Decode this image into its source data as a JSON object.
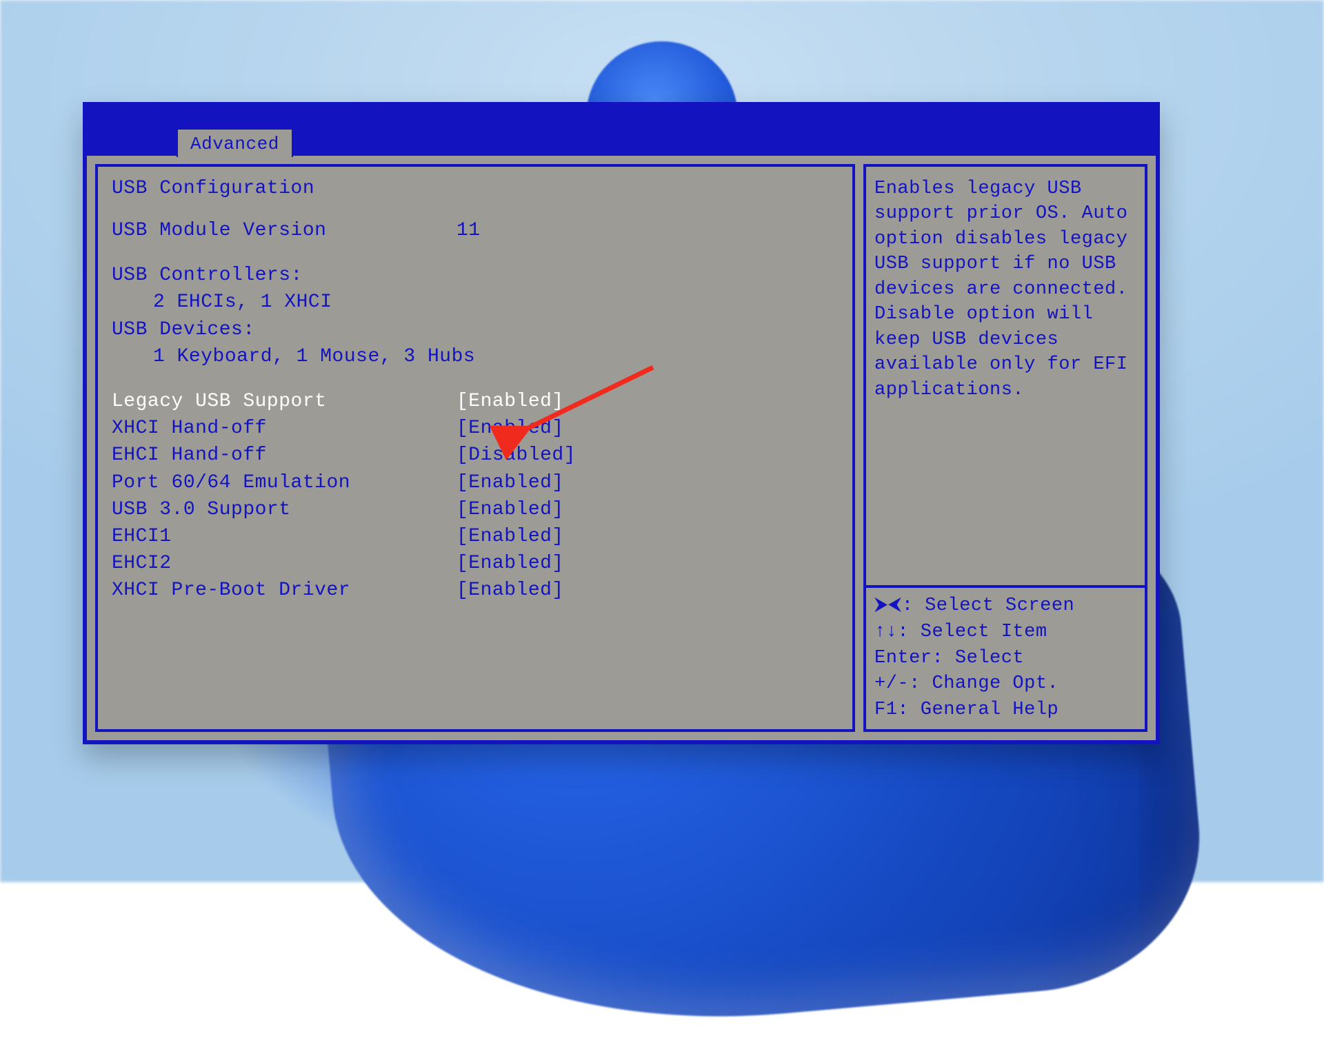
{
  "tab": {
    "label": "Advanced"
  },
  "left": {
    "section_title": "USB Configuration",
    "module_version": {
      "label": "USB Module Version",
      "value": "11"
    },
    "controllers_label": "USB Controllers:",
    "controllers_value": "2 EHCIs, 1 XHCI",
    "devices_label": "USB Devices:",
    "devices_value": "1 Keyboard, 1 Mouse, 3 Hubs",
    "settings": [
      {
        "label": "Legacy USB Support",
        "value": "[Enabled]",
        "selected": true
      },
      {
        "label": "XHCI Hand-off",
        "value": "[Enabled]",
        "selected": false
      },
      {
        "label": "EHCI Hand-off",
        "value": "[Disabled]",
        "selected": false
      },
      {
        "label": "Port 60/64 Emulation",
        "value": "[Enabled]",
        "selected": false
      },
      {
        "label": "USB 3.0 Support",
        "value": "[Enabled]",
        "selected": false
      },
      {
        "label": "EHCI1",
        "value": "[Enabled]",
        "selected": false
      },
      {
        "label": "EHCI2",
        "value": "[Enabled]",
        "selected": false
      },
      {
        "label": "XHCI Pre-Boot Driver",
        "value": "[Enabled]",
        "selected": false
      }
    ]
  },
  "help_text": "Enables legacy USB support prior OS. Auto option disables legacy USB support if no USB devices are connected. Disable option will keep USB devices available only for EFI applications.",
  "keys": {
    "select_screen": "⮞⮜: Select Screen",
    "select_item": "↑↓: Select Item",
    "enter": "Enter: Select",
    "change": "+/-: Change Opt.",
    "general": "F1: General Help"
  },
  "annotation": {
    "arrow_color": "#f02a1c"
  }
}
